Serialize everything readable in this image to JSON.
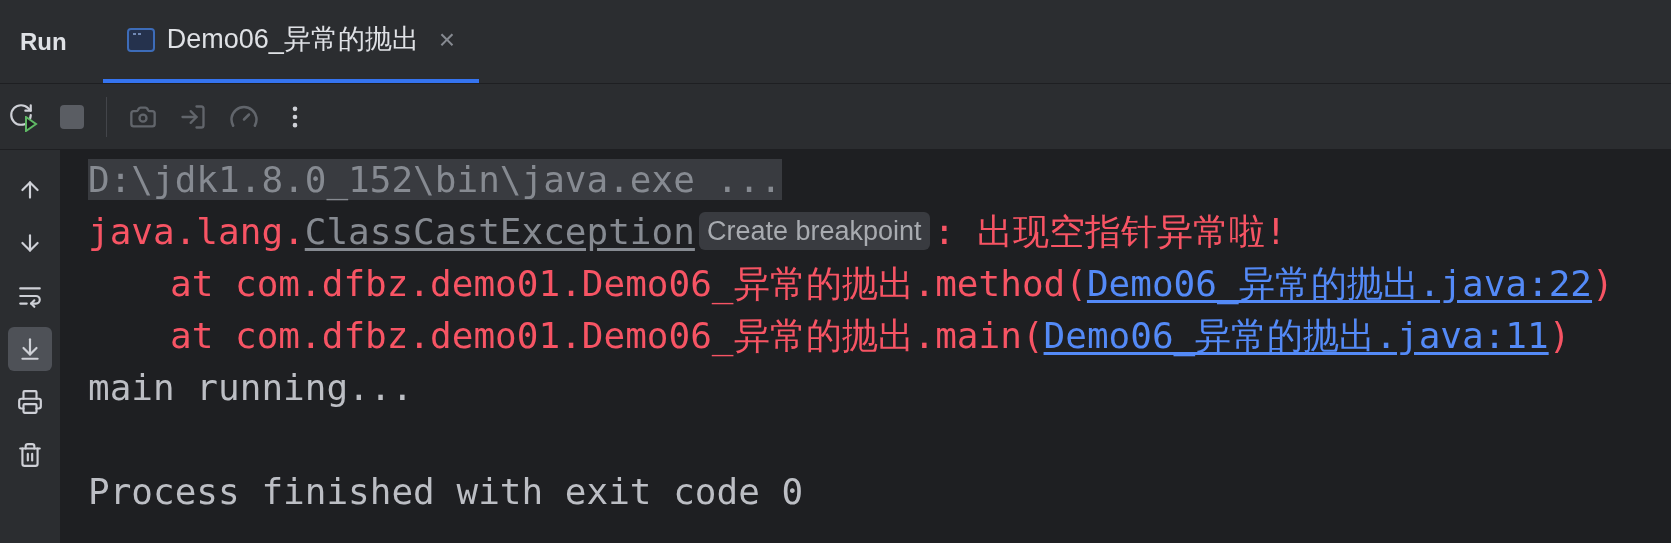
{
  "panel_title": "Run",
  "tabs": [
    {
      "label": "Demo06_异常的抛出",
      "selected": true,
      "close": "×"
    }
  ],
  "toolbar": [
    {
      "kind": "rerun",
      "disabled": false
    },
    {
      "kind": "stop",
      "disabled": true
    },
    {
      "kind": "camera",
      "disabled": true
    },
    {
      "kind": "restore",
      "disabled": true
    },
    {
      "kind": "gauge",
      "disabled": true
    },
    {
      "kind": "more",
      "disabled": false
    }
  ],
  "sidebar": [
    {
      "kind": "up",
      "selected": false
    },
    {
      "kind": "down",
      "selected": false
    },
    {
      "kind": "wrap",
      "selected": false
    },
    {
      "kind": "scroll-end",
      "selected": true
    },
    {
      "kind": "print",
      "selected": false
    },
    {
      "kind": "trash",
      "selected": false
    }
  ],
  "console": [
    {
      "kind": "command",
      "segments": [
        {
          "kind": "command",
          "text": "D:\\jdk1.8.0_152\\bin\\java.exe ..."
        }
      ]
    },
    {
      "kind": "plain",
      "segments": [
        {
          "kind": "error",
          "text": "java.lang."
        },
        {
          "kind": "class",
          "text": "ClassCastException"
        },
        {
          "kind": "badge",
          "text": "Create breakpoint"
        },
        {
          "kind": "error",
          "text": ": 出现空指针异常啦!"
        }
      ]
    },
    {
      "kind": "frame",
      "segments": [
        {
          "kind": "error",
          "text": "at com.dfbz.demo01.Demo06_异常的抛出.method("
        },
        {
          "kind": "link",
          "text": "Demo06_异常的抛出.java:22"
        },
        {
          "kind": "error",
          "text": ")"
        }
      ]
    },
    {
      "kind": "frame",
      "segments": [
        {
          "kind": "error",
          "text": "at com.dfbz.demo01.Demo06_异常的抛出.main("
        },
        {
          "kind": "link",
          "text": "Demo06_异常的抛出.java:11"
        },
        {
          "kind": "error",
          "text": ")"
        }
      ]
    },
    {
      "kind": "plain",
      "segments": [
        {
          "kind": "output",
          "text": "main running..."
        }
      ]
    },
    {
      "kind": "status",
      "segments": [
        {
          "kind": "output",
          "text": "Process finished with exit code 0"
        }
      ]
    }
  ]
}
